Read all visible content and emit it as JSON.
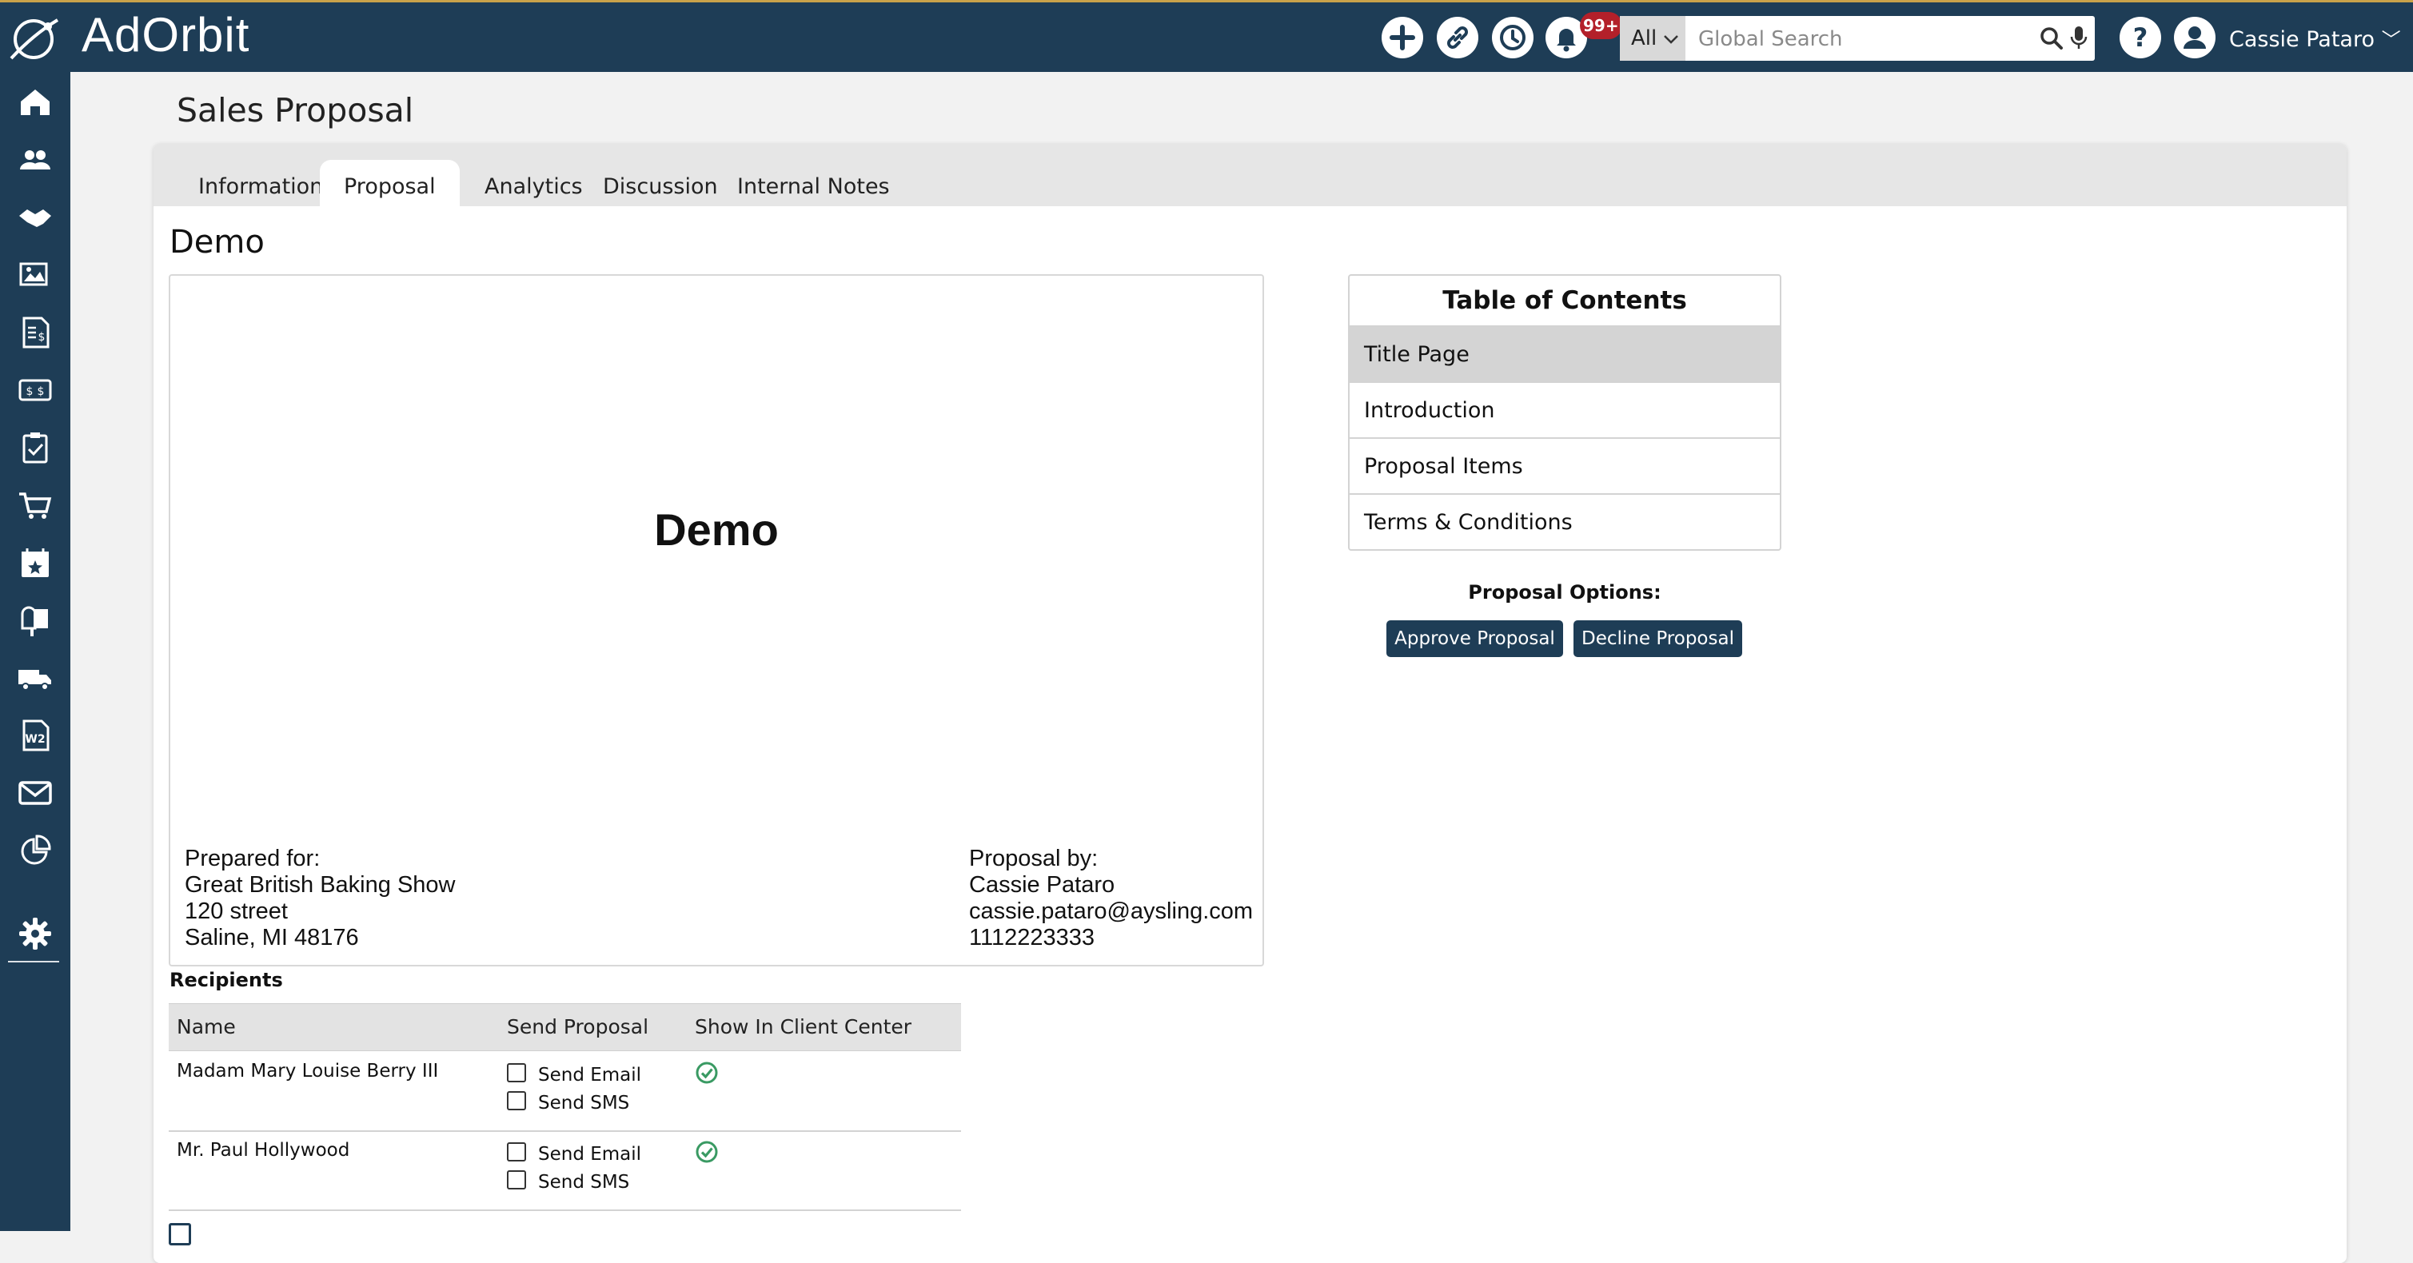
{
  "header": {
    "brand": "Ad Orbit",
    "brand_left": "Ad",
    "brand_o": "O",
    "brand_right": "rbit",
    "notifications_badge": "99+",
    "search": {
      "scope": "All",
      "placeholder": "Global Search"
    },
    "user_name": "Cassie Pataro"
  },
  "nav": {
    "items": [
      "home-icon",
      "users-icon",
      "handshake-icon",
      "media-icon",
      "invoice-icon",
      "billing-icon",
      "clipboard-check-icon",
      "cart-icon",
      "calendar-star-icon",
      "mailbox-icon",
      "truck-icon",
      "w2-icon",
      "mail-icon",
      "chart-icon",
      "gear-icon"
    ]
  },
  "page": {
    "title": "Sales Proposal",
    "tabs": [
      {
        "label": "Information"
      },
      {
        "label": "Proposal"
      },
      {
        "label": "Analytics"
      },
      {
        "label": "Discussion"
      },
      {
        "label": "Internal Notes"
      }
    ],
    "active_tab": "Proposal",
    "document_name": "Demo"
  },
  "preview": {
    "title": "Demo",
    "prepared_for": {
      "label": "Prepared for:",
      "company": "Great British Baking Show",
      "street": "120 street",
      "city": "Saline, MI 48176"
    },
    "proposal_by": {
      "label": "Proposal by:",
      "name": "Cassie Pataro",
      "email": "cassie.pataro@aysling.com",
      "phone": "1112223333"
    }
  },
  "toc": {
    "title": "Table of Contents",
    "items": [
      "Title Page",
      "Introduction",
      "Proposal Items",
      "Terms & Conditions"
    ],
    "selected": "Title Page"
  },
  "options": {
    "label": "Proposal Options:",
    "approve": "Approve Proposal",
    "decline": "Decline Proposal"
  },
  "recipients": {
    "label": "Recipients",
    "columns": [
      "Name",
      "Send Proposal",
      "Show In Client Center"
    ],
    "rows": [
      {
        "name": "Madam Mary Louise Berry III",
        "send_email": "Send Email",
        "send_sms": "Send SMS",
        "email_checked": false,
        "sms_checked": false,
        "show_in_client_center": true
      },
      {
        "name": "Mr. Paul Hollywood",
        "send_email": "Send Email",
        "send_sms": "Send SMS",
        "email_checked": false,
        "sms_checked": false,
        "show_in_client_center": true
      }
    ]
  },
  "colors": {
    "navy": "#1e3d56",
    "badge_red": "#b3202a",
    "check_green": "#3a9a63"
  }
}
